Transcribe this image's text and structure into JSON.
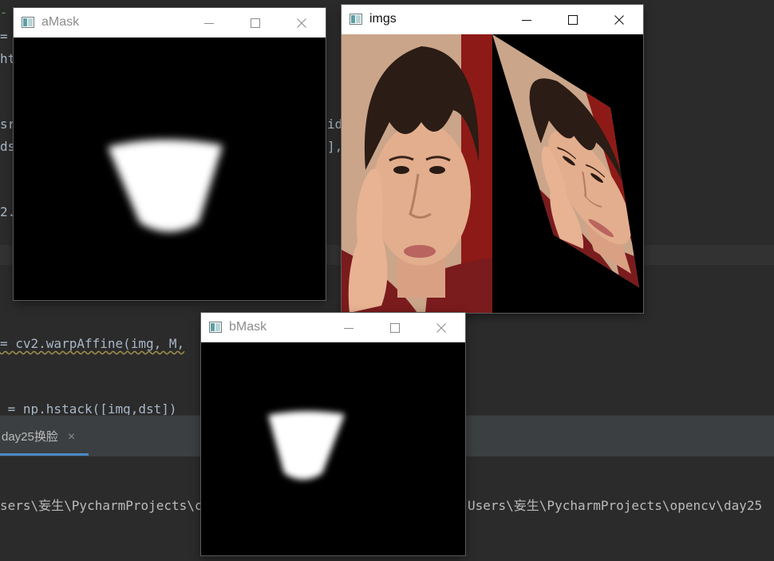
{
  "editor": {
    "lines": [
      {
        "text": "-",
        "kind": "comment"
      },
      {
        "text": "= ",
        "kind": "plain"
      },
      {
        "text": "ht",
        "kind": "plain"
      },
      {
        "text": "sr",
        "kind": "plain"
      },
      {
        "text": "ds",
        "kind": "plain"
      },
      {
        "text": "2.",
        "kind": "plain"
      },
      {
        "text": "id",
        "kind": "plain"
      },
      {
        "text": "],",
        "kind": "plain"
      },
      {
        "text": "= cv2.warpAffine(img, M,",
        "kind": "plain"
      },
      {
        "text": " = np.hstack([img,dst])",
        "kind": "plain"
      }
    ]
  },
  "run_panel": {
    "tab_label": "day25换脸",
    "tab_close": "×",
    "console_left": "sers\\妄生\\PycharmProjects\\c",
    "console_right": "Users\\妄生\\PycharmProjects\\opencv\\day25"
  },
  "windows": {
    "amask": {
      "title": "aMask"
    },
    "imgs": {
      "title": "imgs"
    },
    "bmask": {
      "title": "bMask"
    }
  },
  "colors": {
    "ide_bg": "#2b2b2b",
    "tab_accent": "#4a88c7",
    "titlebar_bg": "#ffffff"
  },
  "icons": {
    "minimize": "minimize-icon",
    "maximize": "maximize-icon",
    "close": "close-icon",
    "app": "opencv-window-icon"
  }
}
